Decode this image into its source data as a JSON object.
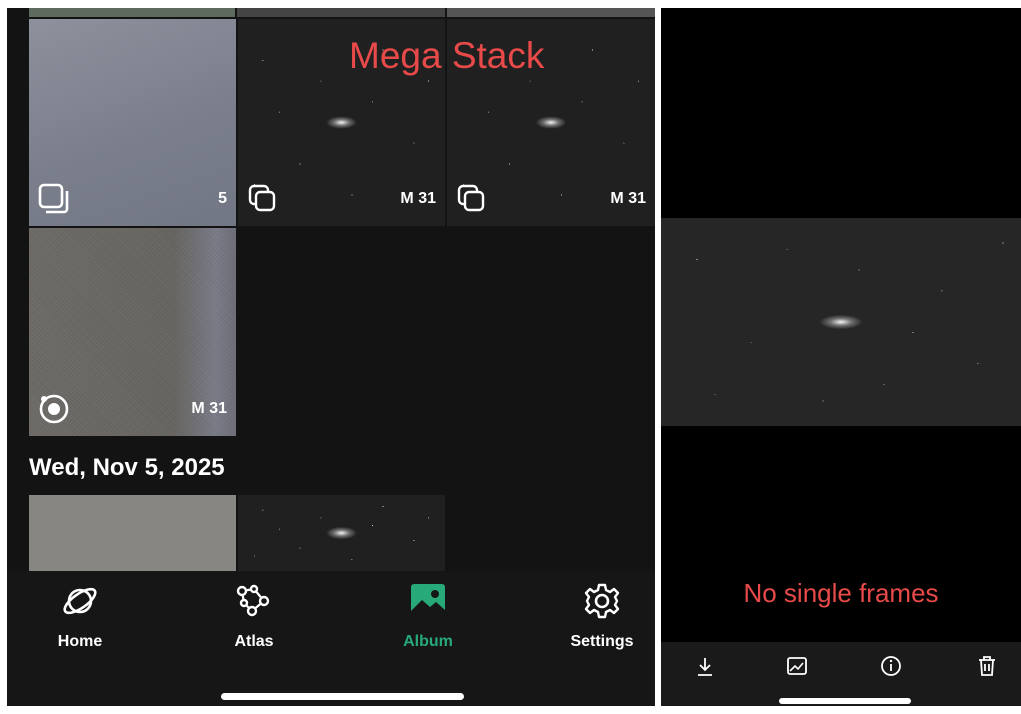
{
  "album": {
    "overlay_title": "Mega Stack",
    "thumbnails": [
      {
        "label": "5",
        "kind": "plain"
      },
      {
        "label": "M 31",
        "kind": "stack"
      },
      {
        "label": "M 31",
        "kind": "stack"
      },
      {
        "label": "M 31",
        "kind": "live"
      }
    ],
    "date_header": "Wed, Nov 5, 2025"
  },
  "tabs": [
    {
      "label": "Home",
      "icon": "planet-icon",
      "active": false
    },
    {
      "label": "Atlas",
      "icon": "constellation-icon",
      "active": false
    },
    {
      "label": "Album",
      "icon": "image-icon",
      "active": true
    },
    {
      "label": "Settings",
      "icon": "gear-icon",
      "active": false
    }
  ],
  "viewer": {
    "message": "No single frames",
    "tools": [
      "download-icon",
      "edit-image-icon",
      "info-icon",
      "trash-icon"
    ]
  },
  "colors": {
    "accent": "#27a97a",
    "annotation": "#e84a4a"
  }
}
